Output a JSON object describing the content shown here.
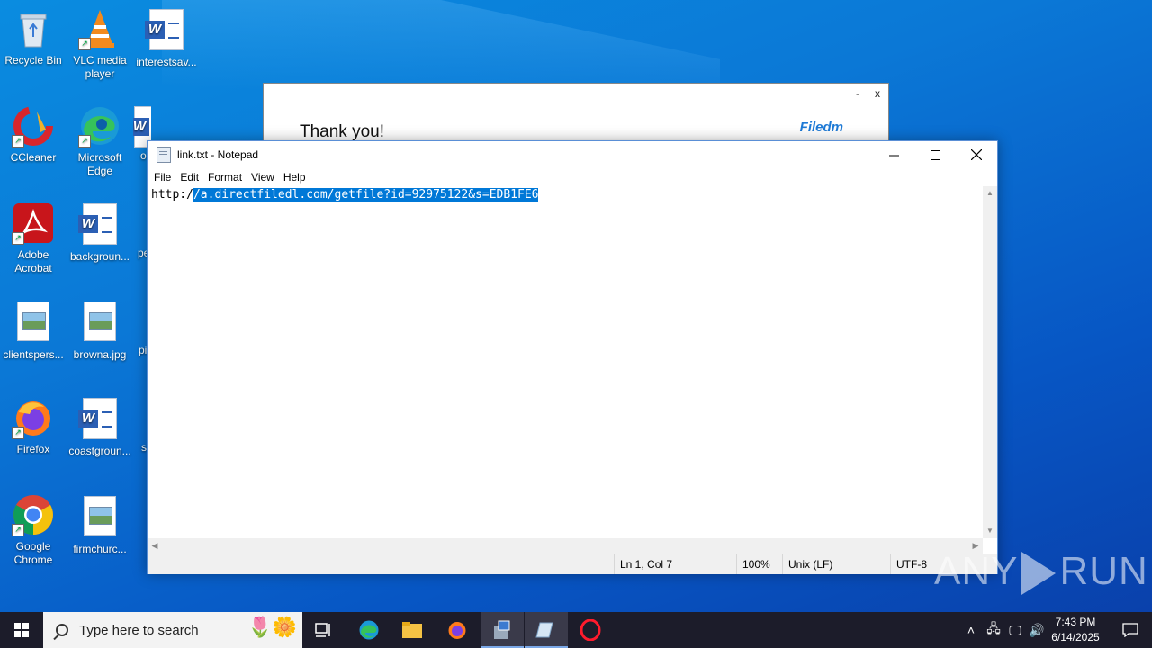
{
  "desktop": {
    "icons": [
      {
        "label": "Recycle Bin"
      },
      {
        "label": "VLC media player"
      },
      {
        "label": "interestsav..."
      },
      {
        "label": "CCleaner"
      },
      {
        "label": "Microsoft Edge"
      },
      {
        "label": "Adobe Acrobat"
      },
      {
        "label": "backgroun..."
      },
      {
        "label": "clientspers..."
      },
      {
        "label": "browna.jpg"
      },
      {
        "label": "Firefox"
      },
      {
        "label": "coastgroun..."
      },
      {
        "label": "Google Chrome"
      },
      {
        "label": "firmchurc..."
      }
    ],
    "partial_labels": [
      "o",
      "pe",
      "pi",
      "s"
    ]
  },
  "background_dialog": {
    "title": "Thank you!",
    "brand": "Filedm",
    "minimize": "-",
    "close": "x"
  },
  "notepad": {
    "title": "link.txt - Notepad",
    "menu": [
      "File",
      "Edit",
      "Format",
      "View",
      "Help"
    ],
    "content_prefix": "http:/",
    "content_selected": "/a.directfiledl.com/getfile?id=92975122&s=EDB1FE6",
    "status": {
      "position": "Ln 1, Col 7",
      "zoom": "100%",
      "line_ending": "Unix (LF)",
      "encoding": "UTF-8"
    }
  },
  "watermark": {
    "left": "ANY",
    "right": "RUN"
  },
  "taskbar": {
    "search_placeholder": "Type here to search",
    "time": "7:43 PM",
    "date": "6/14/2025"
  }
}
